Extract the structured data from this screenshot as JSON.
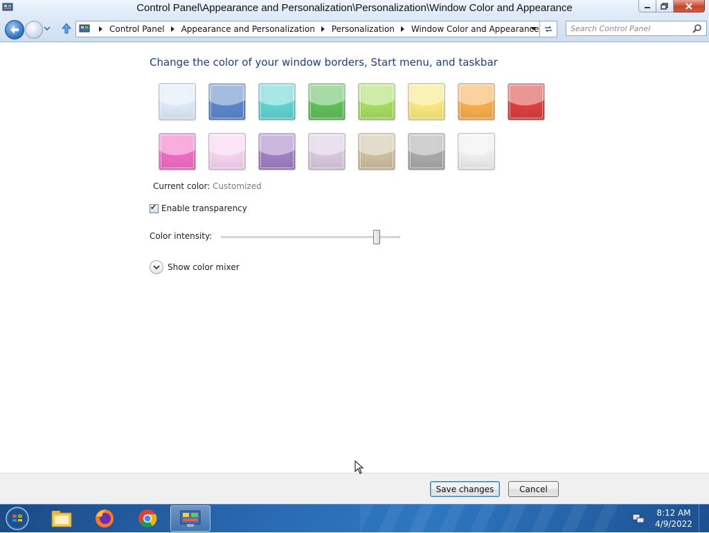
{
  "window": {
    "title": "Control Panel\\Appearance and Personalization\\Personalization\\Window Color and Appearance",
    "controls": [
      "minimize",
      "maximize",
      "close"
    ]
  },
  "address_bar": {
    "breadcrumbs": [
      "Control Panel",
      "Appearance and Personalization",
      "Personalization",
      "Window Color and Appearance"
    ],
    "search_placeholder": "Search Control Panel"
  },
  "main": {
    "heading": "Change the color of your window borders, Start menu, and taskbar",
    "swatches": [
      {
        "name": "sky",
        "color": "#dce9f8"
      },
      {
        "name": "twilight",
        "color": "#5b86c8"
      },
      {
        "name": "sea",
        "color": "#5fd3d0"
      },
      {
        "name": "leaf",
        "color": "#5fbe5a"
      },
      {
        "name": "lime",
        "color": "#a6dc62"
      },
      {
        "name": "lemon",
        "color": "#f7e77b"
      },
      {
        "name": "orange",
        "color": "#f8ac4e"
      },
      {
        "name": "ruby",
        "color": "#d9403f"
      },
      {
        "name": "fuchsia",
        "color": "#f06cc4"
      },
      {
        "name": "blush",
        "color": "#f6d2ef"
      },
      {
        "name": "violet",
        "color": "#9f7fc4"
      },
      {
        "name": "lavender",
        "color": "#d8c8de"
      },
      {
        "name": "taupe",
        "color": "#cbbf9e"
      },
      {
        "name": "chocolate",
        "color": "#a9a9a9"
      },
      {
        "name": "frost",
        "color": "#eeeeee"
      }
    ],
    "current_color_label": "Current color:",
    "current_color_value": "Customized",
    "transparency_label": "Enable transparency",
    "transparency_checked": true,
    "intensity_label": "Color intensity:",
    "intensity_level": 0.87,
    "mixer_label": "Show color mixer"
  },
  "footer": {
    "save_label": "Save changes",
    "cancel_label": "Cancel"
  },
  "taskbar": {
    "items": [
      "start-orb",
      "file-explorer",
      "firefox",
      "chrome",
      "control-panel"
    ],
    "time": "8:12 AM",
    "date": "4/9/2022"
  }
}
